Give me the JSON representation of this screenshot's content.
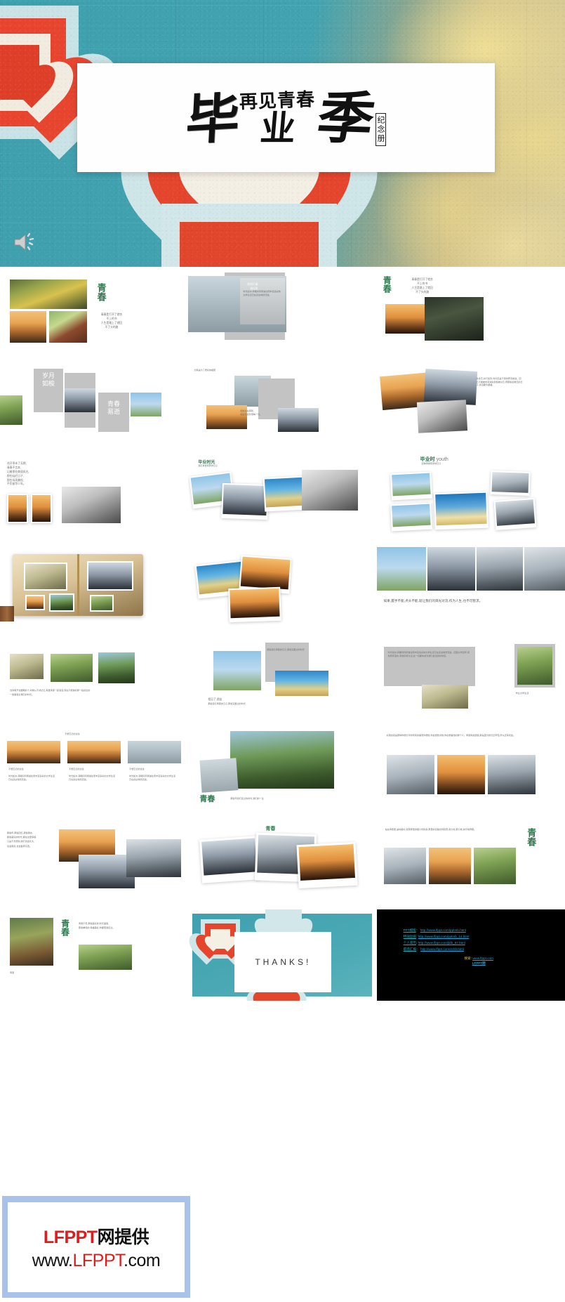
{
  "hero": {
    "title_main": "毕",
    "title_top": "再见青春",
    "title_mid": "业",
    "title_tall": "季",
    "seal": "纪念册",
    "speaker_icon": "speaker-icon"
  },
  "slides": [
    {
      "index": 1,
      "name": "youth-intro",
      "heading": "青春",
      "body": "青春是打开了就合\n不上的书\n人生是踏上了就回\n不了头的路"
    },
    {
      "index": 2,
      "name": "pack-up-set-off",
      "heading": "收拾行囊",
      "subheading": "再出发",
      "body": "时光如水,转眼间风雨暑往而丰富多彩的大学生活已在身边悄然流逝。"
    },
    {
      "index": 3,
      "name": "youth-right",
      "heading": "青春",
      "body": "青春是打开了就合\n不上的书\n人生是踏上了就回\n不了头的路"
    },
    {
      "index": 4,
      "name": "years-fly-by",
      "heading_a": "岁月\n如梭",
      "heading_b": "青春\n易逝"
    },
    {
      "index": 5,
      "name": "parting-for-reunion",
      "caption_top": "分离是为了更好的相聚",
      "caption_mid": "相逢总关离别,\n相逢更加珍惜每一分。"
    },
    {
      "index": 6,
      "name": "memories-collage",
      "body": "许多忘,并行如影,时间还是不停的奔流前进。回忆不能被时间消失慢慢被淡忘,而那些最难忘的日子,永远都珍藏着。"
    },
    {
      "index": 7,
      "name": "poem-frames",
      "body": "花开季未了无期,\n青春不言弃,\n记着那些美丽风光,\n那些灿烂日子,\n那些风雨兼程,\n不负韶华少年。"
    },
    {
      "index": 8,
      "name": "camera-memories",
      "heading": "毕业时光",
      "sub": "追忆青春有梦的日子"
    },
    {
      "index": 9,
      "name": "graduation-youth",
      "heading_cn": "毕业时",
      "heading_en": "youth",
      "sub": "回味青春有梦的日子"
    },
    {
      "index": 10,
      "name": "photo-album",
      "heading": ""
    },
    {
      "index": 11,
      "name": "sunset-silhouettes",
      "heading": ""
    },
    {
      "index": 12,
      "name": "hands-quote",
      "body": "如果,握手不能,点头不能,就让我们的目光对流,作为人生,也不可暂求。"
    },
    {
      "index": 13,
      "name": "campus-memory-three",
      "body": "当你离开也要期的十,时候从不成记忆,有爱青春一起浪漫,现在不能够的那一段感念的\n一些事发生难忘的时光。"
    },
    {
      "index": 14,
      "name": "see-you-again",
      "heading": "相见了,朋友",
      "body": "那些追忆青春的日子,那些深爱过的时光"
    },
    {
      "index": 15,
      "name": "university-memory",
      "heading": "毕业大学生活",
      "body": "时光如水,转眼间风雨暑往而丰富多彩的大学生活已在身边悄然流逝。回望大学四年,有欢笑有泪水,有收获有付出,这一切都将成为我们最宝贵的财富。"
    },
    {
      "index": 16,
      "name": "unforgettable-three-col",
      "heading": "不想忘记的过往",
      "body": "时光如水,转眼间风雨暑往而丰富多彩的大学生活已在身边悄然流逝。",
      "columns": 3
    },
    {
      "index": 17,
      "name": "tree-youth",
      "heading": "青春",
      "body": "那些年我们走过的时光,我们的一生"
    },
    {
      "index": 18,
      "name": "classroom-grad",
      "body": "好朋友就是那种你想分享你所有的事而你想他,你会想告诉他,你在想着他的那个人。青春有些遗憾,那是因为我们还年轻,所以还有机会。"
    },
    {
      "index": 19,
      "name": "memories-left-text",
      "body": "那些年,那些回忆,那些朋友,\n那些美好的时光,都在这里停留,\n只是不曾想到,我们也会长大,\n也会离别,也会各奔东西。"
    },
    {
      "index": 20,
      "name": "youth-polaroid",
      "heading": "青春"
    },
    {
      "index": 21,
      "name": "youth-right-green",
      "heading": "青春",
      "body": "站在青春里,遍地美好,就算那里的烟火特别多,那里的道路也特别宽,用力地,努力地,快乐地奔跑。"
    },
    {
      "index": 22,
      "name": "campus-path-youth",
      "heading": "青春",
      "body": "青春不老,那些美好的,时光美丽,\n那些单纯的,幸福美好,你都陪我走过。"
    },
    {
      "index": 23,
      "name": "thanks",
      "thanks": "THANKS!"
    },
    {
      "index": 24,
      "name": "links",
      "links": [
        {
          "label": "PPT模版",
          "sep": "：",
          "url": "http://www.lfppt.com/pptmb.html"
        },
        {
          "label": "特效动画",
          "sep": ":",
          "url": "http://www.lfppt.com/pptmb_14.html"
        },
        {
          "label": "个人简历",
          "sep": ":",
          "url": "http://www.lfppt.com/jldb_67.html"
        },
        {
          "label": "职场汇报",
          "sep": "：",
          "url": "http://www.lfppt.com/zchb.html"
        }
      ],
      "search_label": "搜索:",
      "search_site": "www.lfppt.com",
      "search_brand": "LFPPT网"
    }
  ],
  "watermark": {
    "line1_red": "LFPPT",
    "line1_black": "网提供",
    "line2_pre": "www.",
    "line2_red": "LFPPT",
    "line2_post": ".com",
    "border_color": "#a8c2ea",
    "accent_color": "#e01b1b"
  }
}
